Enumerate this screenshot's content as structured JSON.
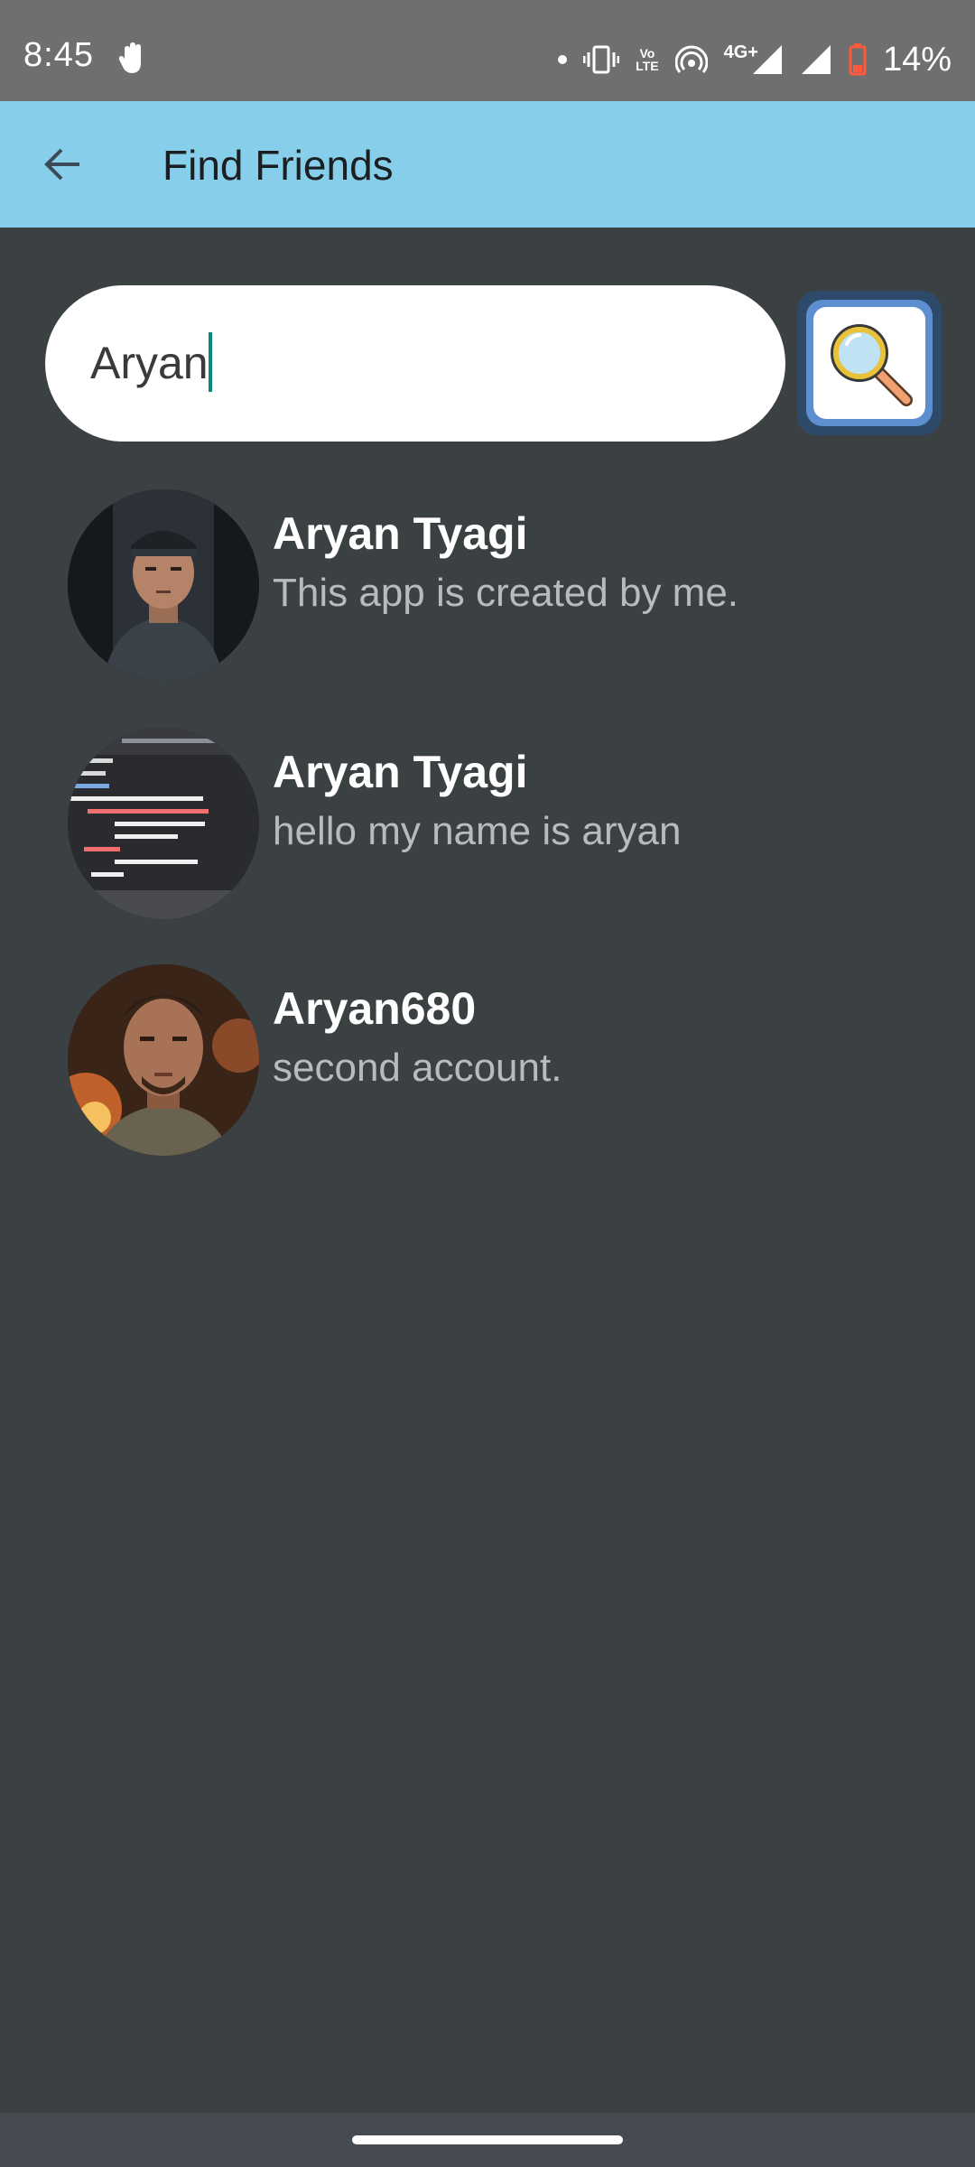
{
  "status_bar": {
    "time": "8:45",
    "volte_top": "Vo",
    "volte_bottom": "LTE",
    "network": "4G+",
    "battery": "14%"
  },
  "app_bar": {
    "title": "Find Friends"
  },
  "search": {
    "value": "Aryan",
    "button_icon": "magnifier-icon"
  },
  "results": [
    {
      "name": "Aryan Tyagi",
      "status": "This app is created by me.",
      "avatar": "profile-photo"
    },
    {
      "name": "Aryan Tyagi",
      "status": "hello my name is aryan",
      "avatar": "code-photo"
    },
    {
      "name": "Aryan680",
      "status": "second account.",
      "avatar": "profile-photo"
    }
  ],
  "colors": {
    "app_bar": "#87ceeb",
    "background": "#3b4042",
    "status_bar": "#6f6f6f"
  }
}
